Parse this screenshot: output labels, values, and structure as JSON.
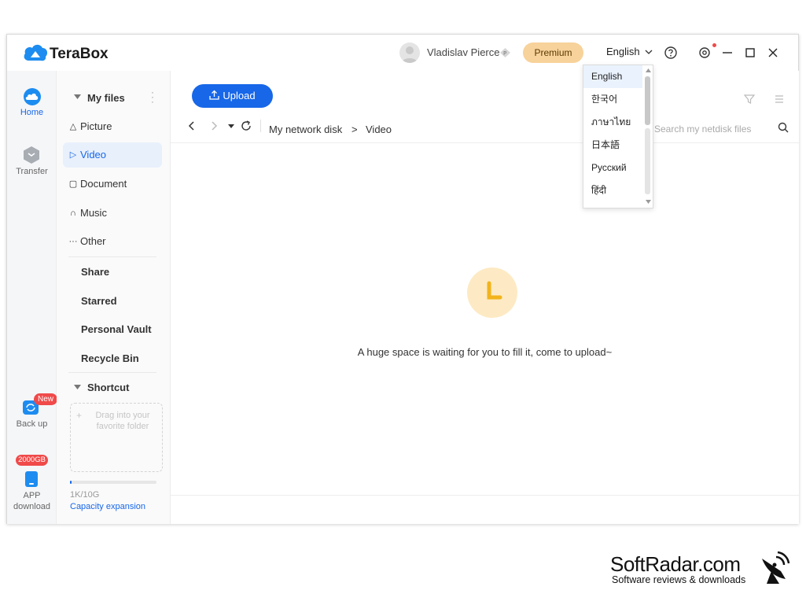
{
  "app": {
    "title": "TeraBox"
  },
  "header": {
    "user_name": "Vladislav Pierce",
    "premium_label": "Premium",
    "language": "English"
  },
  "language_menu": {
    "options": [
      "English",
      "한국어",
      "ภาษาไทย",
      "日本語",
      "Русский",
      "हिंदी"
    ],
    "selected": "English"
  },
  "rail": {
    "home": "Home",
    "transfer": "Transfer",
    "new_badge": "New",
    "backup": "Back up",
    "storage_badge": "2000GB",
    "app_download_1": "APP",
    "app_download_2": "download"
  },
  "sidebar": {
    "my_files": "My files",
    "picture": "Picture",
    "video": "Video",
    "document": "Document",
    "music": "Music",
    "other": "Other",
    "share": "Share",
    "starred": "Starred",
    "personal_vault": "Personal Vault",
    "recycle_bin": "Recycle Bin",
    "shortcut": "Shortcut",
    "drag_hint": "Drag into your favorite folder",
    "storage_used": "1K/10G",
    "storage_fraction": 0.02,
    "capacity_expansion": "Capacity expansion"
  },
  "main": {
    "upload_label": "Upload",
    "breadcrumb_root": "My network disk",
    "breadcrumb_sep": ">",
    "breadcrumb_current": "Video",
    "search_placeholder": "Search my netdisk files",
    "empty_message": "A huge space is waiting for you to fill it, come to upload~"
  },
  "watermark": {
    "title": "SoftRadar.com",
    "subtitle": "Software reviews & downloads"
  },
  "colors": {
    "accent": "#1767e8",
    "premium": "#f7d29a",
    "new_badge": "#f04a4a",
    "empty_icon_bg": "#fdeac4",
    "empty_icon_fg": "#f2b31c"
  }
}
